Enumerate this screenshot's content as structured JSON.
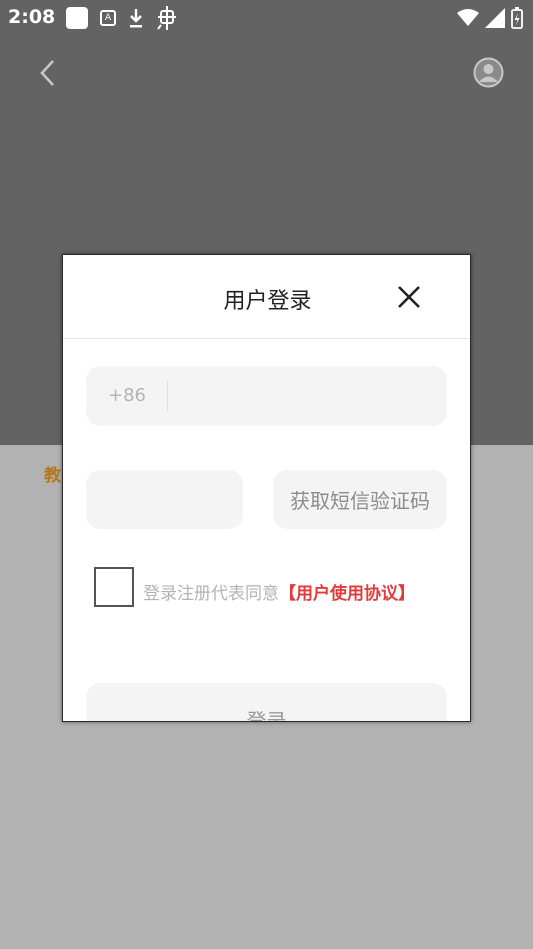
{
  "status_bar": {
    "time": "2:08"
  },
  "background": {
    "side_text": "教"
  },
  "dialog": {
    "title": "用户登录",
    "phone": {
      "country_code": "+86",
      "value": "",
      "placeholder": ""
    },
    "sms_code": {
      "value": "",
      "placeholder": ""
    },
    "sms_button_label": "获取短信验证码",
    "agreement": {
      "text": "登录注册代表同意",
      "link": "【用户使用协议】",
      "checked": false
    },
    "login_label": "登录"
  },
  "icons": {
    "back": "back-arrow-icon",
    "account": "account-circle-icon",
    "close": "close-icon"
  },
  "colors": {
    "link": "#e33b3b",
    "overlay_top": "#636363",
    "overlay_bottom": "#b2b2b2"
  }
}
